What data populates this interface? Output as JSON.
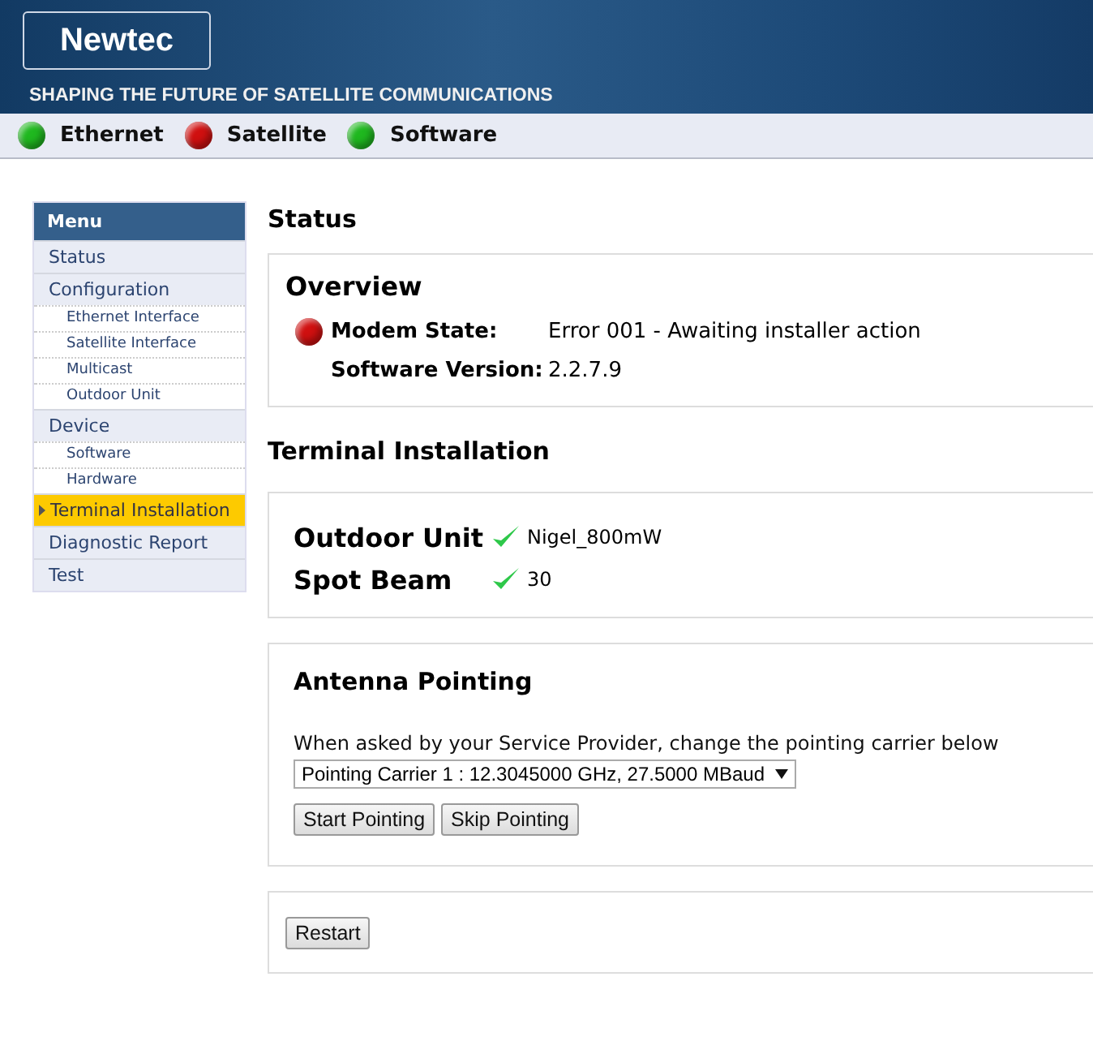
{
  "header": {
    "logo": "Newtec",
    "tagline": "SHAPING THE FUTURE OF SATELLITE COMMUNICATIONS"
  },
  "indicators": [
    {
      "label": "Ethernet",
      "color": "#1fb81f"
    },
    {
      "label": "Satellite",
      "color": "#d01010"
    },
    {
      "label": "Software",
      "color": "#1fb81f"
    }
  ],
  "menu": {
    "title": "Menu",
    "items": [
      {
        "label": "Status",
        "kind": "top",
        "selected": false
      },
      {
        "label": "Configuration",
        "kind": "top",
        "selected": false
      },
      {
        "label": "Ethernet Interface",
        "kind": "sub",
        "selected": false
      },
      {
        "label": "Satellite Interface",
        "kind": "sub",
        "selected": false
      },
      {
        "label": "Multicast",
        "kind": "sub",
        "selected": false
      },
      {
        "label": "Outdoor Unit",
        "kind": "sub",
        "selected": false
      },
      {
        "label": "Device",
        "kind": "top",
        "selected": false
      },
      {
        "label": "Software",
        "kind": "sub",
        "selected": false
      },
      {
        "label": "Hardware",
        "kind": "sub",
        "selected": false
      },
      {
        "label": "Terminal Installation",
        "kind": "top",
        "selected": true
      },
      {
        "label": "Diagnostic Report",
        "kind": "top",
        "selected": false
      },
      {
        "label": "Test",
        "kind": "top",
        "selected": false
      }
    ]
  },
  "page_title": "Status",
  "overview": {
    "title": "Overview",
    "rows": [
      {
        "label": "Modem State:",
        "value": "Error 001 - Awaiting installer action",
        "color": "#d01010"
      },
      {
        "label": "Software Version:",
        "value": "2.2.7.9"
      }
    ]
  },
  "installation": {
    "title": "Terminal Installation",
    "checks": [
      {
        "label": "Outdoor Unit",
        "value": "Nigel_800mW",
        "checked": true
      },
      {
        "label": "Spot Beam",
        "value": "30",
        "checked": true
      }
    ]
  },
  "pointing": {
    "title": "Antenna Pointing",
    "instruction": "When asked by your Service Provider, change the pointing carrier below",
    "carrier": "Pointing Carrier 1 : 12.3045000 GHz, 27.5000 MBaud",
    "buttons": [
      "Start Pointing",
      "Skip Pointing"
    ]
  },
  "restart_button": "Restart"
}
